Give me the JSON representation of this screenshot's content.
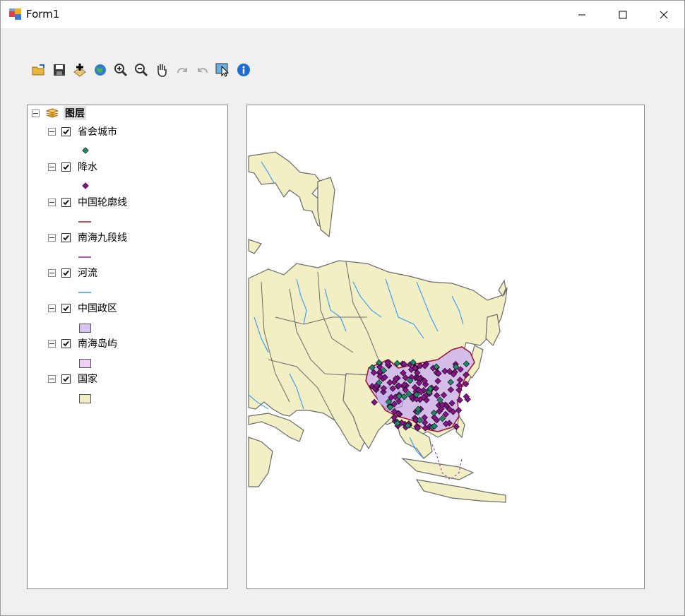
{
  "window": {
    "title": "Form1"
  },
  "toolbar": {
    "tools": [
      "open-icon",
      "save-icon",
      "add-data-icon",
      "full-extent-icon",
      "zoom-in-icon",
      "zoom-out-icon",
      "pan-icon",
      "redo-icon",
      "undo-icon",
      "select-icon",
      "identify-icon"
    ]
  },
  "toc": {
    "root_label": "图层",
    "layers": [
      {
        "name": "省会城市",
        "symbol": "point",
        "color": "#1e8a6a"
      },
      {
        "name": "降水",
        "symbol": "point",
        "color": "#8b108b"
      },
      {
        "name": "中国轮廓线",
        "symbol": "line",
        "color": "#a0102a"
      },
      {
        "name": "南海九段线",
        "symbol": "line",
        "color": "#9b1aa0"
      },
      {
        "name": "河流",
        "symbol": "line",
        "color": "#2aa0e0"
      },
      {
        "name": "中国政区",
        "symbol": "fill",
        "color": "#d9c3f0"
      },
      {
        "name": "南海岛屿",
        "symbol": "fill",
        "color": "#efcff5"
      },
      {
        "name": "国家",
        "symbol": "fill",
        "color": "#f2eec3"
      }
    ]
  },
  "colors": {
    "land": "#f3efc4",
    "border": "#6a6a6a",
    "river": "#1e90ff",
    "china_fill": "#d4bde8",
    "china_outline": "#a0102a",
    "precip": "#8b108b",
    "capital": "#1e8a6a"
  }
}
